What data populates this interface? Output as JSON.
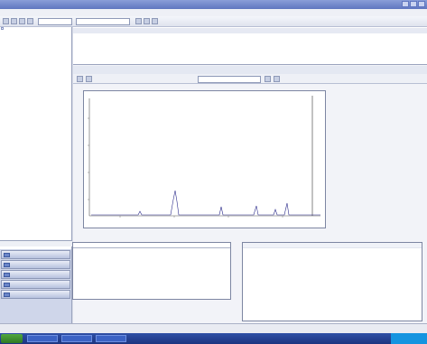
{
  "window": {
    "title": ""
  },
  "menu": {
    "items": []
  },
  "toolbar": {
    "combo1": "",
    "combo2": ""
  },
  "tree": {
    "root": "",
    "items": []
  },
  "nav": {
    "label": "",
    "buttons": [
      {
        "label": "",
        "icon": "folder-icon"
      },
      {
        "label": "",
        "icon": "document-icon"
      },
      {
        "label": "",
        "icon": "gear-icon"
      },
      {
        "label": "",
        "icon": "chart-icon"
      },
      {
        "label": "",
        "icon": "report-icon"
      }
    ]
  },
  "grid": {
    "headers": [],
    "row": []
  },
  "tabs": [],
  "viewbar": {
    "selector": ""
  },
  "plot": {
    "title": ""
  },
  "info": {
    "title": "",
    "rows": []
  },
  "peaks": {
    "headers": [],
    "rows": []
  },
  "status": {
    "text": ""
  }
}
